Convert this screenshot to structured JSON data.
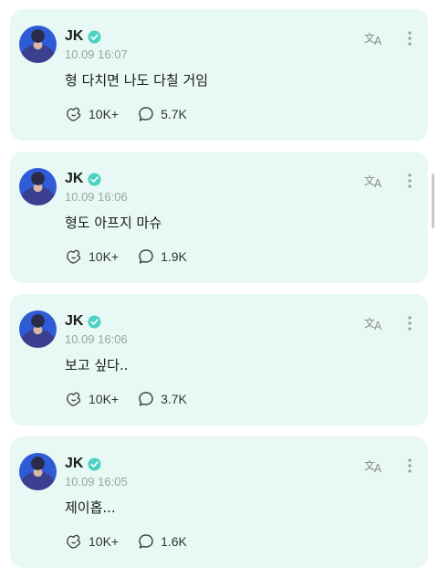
{
  "posts": [
    {
      "author": "JK",
      "timestamp": "10.09 16:07",
      "message": "형 다치면 나도 다칠 거임",
      "likes": "10K+",
      "comments": "5.7K"
    },
    {
      "author": "JK",
      "timestamp": "10.09 16:06",
      "message": "형도 아프지 마슈",
      "likes": "10K+",
      "comments": "1.9K"
    },
    {
      "author": "JK",
      "timestamp": "10.09 16:06",
      "message": "보고 싶다..",
      "likes": "10K+",
      "comments": "3.7K"
    },
    {
      "author": "JK",
      "timestamp": "10.09 16:05",
      "message": "제이홉...",
      "likes": "10K+",
      "comments": "1.6K"
    }
  ],
  "icons": {
    "verified": "verified-badge-icon",
    "translate": "translate-icon",
    "more": "more-vertical-icon",
    "like": "like-icon",
    "comment": "comment-icon"
  },
  "colors": {
    "card_background": "#e8f9f5",
    "verified": "#4cd1c3",
    "timestamp": "#9aa3a1"
  }
}
